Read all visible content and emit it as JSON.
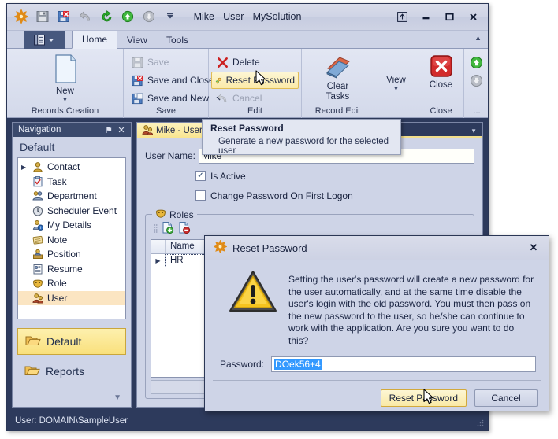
{
  "window": {
    "title": "Mike - User - MySolution",
    "quick_access": [
      {
        "name": "app-menu-icon",
        "label": "Application Menu"
      },
      {
        "name": "save-icon",
        "label": "Save"
      },
      {
        "name": "save-and-close-icon",
        "label": "Save and Close"
      },
      {
        "name": "undo-icon",
        "label": "Undo"
      },
      {
        "name": "refresh-icon",
        "label": "Refresh"
      },
      {
        "name": "previous-object-icon",
        "label": "Previous Object"
      },
      {
        "name": "next-object-icon",
        "label": "Next Object"
      },
      {
        "name": "customize-quick-access-icon",
        "label": "Customize Quick Access Toolbar"
      }
    ],
    "buttons": [
      {
        "name": "restore-ribbon-button",
        "glyph": "⬆"
      },
      {
        "name": "minimize-button",
        "glyph": "–"
      },
      {
        "name": "maximize-button",
        "glyph": "❑"
      },
      {
        "name": "close-button",
        "glyph": "✕"
      }
    ]
  },
  "ribbon": {
    "tabs": [
      {
        "label": "Home",
        "active": true
      },
      {
        "label": "View",
        "active": false
      },
      {
        "label": "Tools",
        "active": false
      }
    ],
    "collapse_glyph": "▲",
    "groups": [
      {
        "title": "Records Creation",
        "big": {
          "label": "New",
          "icon": "new-document-icon",
          "has_dropdown": true
        }
      },
      {
        "title": "Save",
        "items": [
          {
            "label": "Save",
            "icon": "save-icon",
            "disabled": true,
            "dropdown": false
          },
          {
            "label": "Save and Close",
            "icon": "save-and-close-icon",
            "disabled": false,
            "dropdown": false
          },
          {
            "label": "Save and New",
            "icon": "save-and-new-icon",
            "disabled": false,
            "dropdown": true
          }
        ]
      },
      {
        "title": "Edit",
        "items": [
          {
            "label": "Delete",
            "icon": "delete-icon",
            "disabled": false,
            "dropdown": false
          },
          {
            "label": "Reset Password",
            "icon": "reset-password-icon",
            "disabled": false,
            "dropdown": false,
            "hot": true
          },
          {
            "label": "Cancel",
            "icon": "cancel-icon",
            "disabled": true,
            "dropdown": false
          }
        ]
      },
      {
        "title": "Record Edit",
        "big": {
          "label": "Clear\nTasks",
          "icon": "eraser-icon",
          "has_dropdown": false
        }
      },
      {
        "title": "",
        "big": {
          "label": "View",
          "icon": "",
          "has_dropdown": true
        }
      },
      {
        "title": "Close",
        "big": {
          "label": "Close",
          "icon": "close-red-icon",
          "has_dropdown": false
        }
      },
      {
        "title": "...",
        "items": [
          {
            "label": "",
            "icon": "previous-object-icon",
            "disabled": false
          },
          {
            "label": "",
            "icon": "next-object-icon",
            "disabled": true
          }
        ]
      }
    ]
  },
  "navigation": {
    "header": "Navigation",
    "header_icons": [
      {
        "name": "pin-icon",
        "glyph": "⚑"
      },
      {
        "name": "close-navigation-icon",
        "glyph": "✕"
      }
    ],
    "group_title": "Default",
    "items": [
      {
        "label": "Contact",
        "icon": "contact-icon",
        "expandable": true,
        "selected": false
      },
      {
        "label": "Task",
        "icon": "task-icon",
        "expandable": false,
        "selected": false
      },
      {
        "label": "Department",
        "icon": "department-icon",
        "expandable": false,
        "selected": false
      },
      {
        "label": "Scheduler Event",
        "icon": "scheduler-event-icon",
        "expandable": false,
        "selected": false
      },
      {
        "label": "My Details",
        "icon": "my-details-icon",
        "expandable": false,
        "selected": false
      },
      {
        "label": "Note",
        "icon": "note-icon",
        "expandable": false,
        "selected": false
      },
      {
        "label": "Position",
        "icon": "position-icon",
        "expandable": false,
        "selected": false
      },
      {
        "label": "Resume",
        "icon": "resume-icon",
        "expandable": false,
        "selected": false
      },
      {
        "label": "Role",
        "icon": "role-icon",
        "expandable": false,
        "selected": false
      },
      {
        "label": "User",
        "icon": "user-icon",
        "expandable": false,
        "selected": true
      }
    ],
    "groups": [
      {
        "label": "Default",
        "icon": "folder-icon",
        "active": true
      },
      {
        "label": "Reports",
        "icon": "folder-icon",
        "active": false
      }
    ],
    "more_glyph": "▼"
  },
  "document": {
    "tab": {
      "label": "Mike - User",
      "icon": "user-icon"
    },
    "tab_menu_glyph": "▼",
    "fields": {
      "user_name_label": "User Name:",
      "user_name_value": "Mike",
      "user_name_placeholder": ""
    },
    "checkboxes": [
      {
        "label": "Is Active",
        "checked": true
      },
      {
        "label": "Change Password On First Logon",
        "checked": false
      }
    ],
    "roles": {
      "legend": "Roles",
      "toolbar": [
        {
          "name": "new-role-icon",
          "label": "New"
        },
        {
          "name": "remove-role-icon",
          "label": "Remove"
        }
      ],
      "columns": [
        "Name"
      ],
      "rows": [
        {
          "indicator": "▶",
          "name": "HR"
        }
      ]
    }
  },
  "tooltip": {
    "title": "Reset Password",
    "body": "Generate a new password for the selected user"
  },
  "dialog": {
    "title": "Reset Password",
    "title_icon": "gear-icon",
    "close_glyph": "✕",
    "warning_icon": "warning-triangle-icon",
    "message": "Setting the user's password will create a new password for the user automatically, and at the same time disable the user's login with the old password. You must then pass on the new password to the user, so he/she can continue to work with the application. Are you sure you want to do this?",
    "password_label": "Password:",
    "password_value": "DOek56+4",
    "buttons": [
      {
        "label": "Reset Password",
        "hot": true
      },
      {
        "label": "Cancel",
        "hot": false
      }
    ]
  },
  "status_bar": {
    "text": "User: DOMAIN\\SampleUser"
  },
  "colors": {
    "window_chrome": "#cdd3e6",
    "dark_navy": "#2d3a5c",
    "accent_yellow": "#f8e48e",
    "selection_blue": "#3399ff",
    "highlight_orange": "#fbe5c2"
  }
}
